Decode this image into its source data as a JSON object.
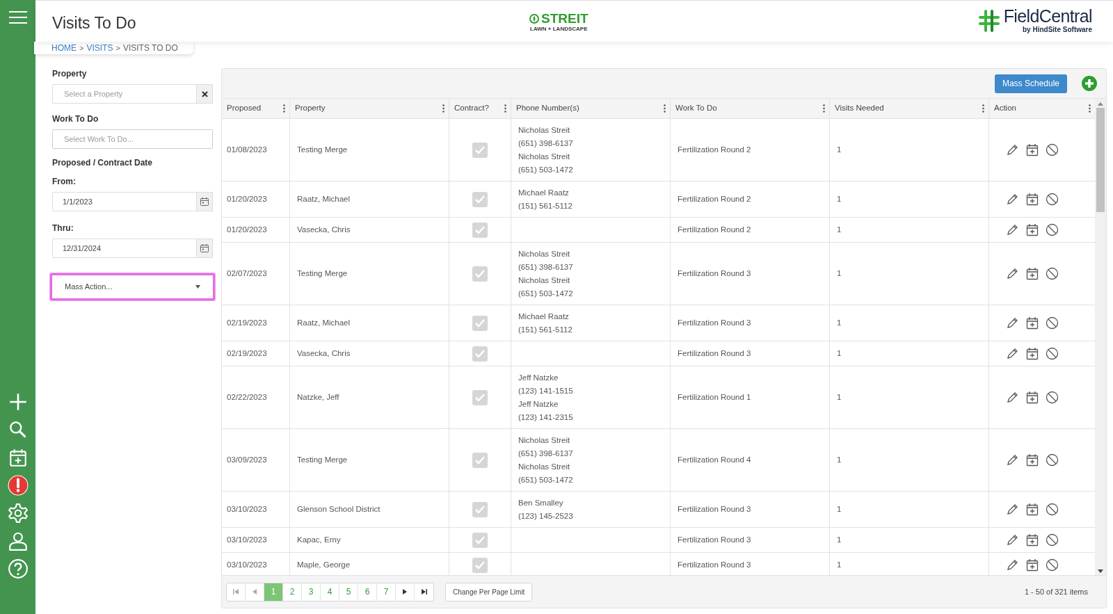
{
  "header": {
    "title": "Visits To Do",
    "brand_logo": {
      "name": "STREIT",
      "tagline": "LAWN + LANDSCAPE"
    },
    "app_logo": {
      "name": "FieldCentral",
      "tagline": "by HindSite Software"
    }
  },
  "breadcrumb": {
    "separator": ">",
    "items": [
      {
        "label": "HOME",
        "link": true
      },
      {
        "label": "VISITS",
        "link": true
      },
      {
        "label": "VISITS TO DO",
        "link": false
      }
    ]
  },
  "sidebar": {
    "items": [
      {
        "kind": "add"
      },
      {
        "kind": "search"
      },
      {
        "kind": "calendar"
      },
      {
        "kind": "alert"
      },
      {
        "kind": "settings"
      },
      {
        "kind": "user"
      },
      {
        "kind": "help"
      }
    ]
  },
  "filters": {
    "property": {
      "label": "Property",
      "placeholder": "Select a Property"
    },
    "work_to_do": {
      "label": "Work To Do",
      "placeholder": "Select Work To Do..."
    },
    "date_label": "Proposed / Contract Date",
    "from": {
      "label": "From:",
      "value": "1/1/2023"
    },
    "thru": {
      "label": "Thru:",
      "value": "12/31/2024"
    },
    "mass_action": {
      "value": "Mass Action...",
      "highlighted": true
    }
  },
  "toolbar": {
    "mass_schedule": "Mass Schedule"
  },
  "table": {
    "columns": [
      "Proposed",
      "Property",
      "Contract?",
      "Phone Number(s)",
      "Work To Do",
      "Visits Needed",
      "Action"
    ],
    "rows": [
      {
        "proposed": "01/08/2023",
        "property": "Testing Merge",
        "contract": true,
        "phones": [
          "Nicholas Streit",
          "(651) 398-6137",
          "Nicholas Streit",
          "(651) 503-1472"
        ],
        "work": "Fertilization Round 2",
        "visits": "1"
      },
      {
        "proposed": "01/20/2023",
        "property": "Raatz, Michael",
        "contract": true,
        "phones": [
          "Michael Raatz",
          "(151) 561-5112"
        ],
        "work": "Fertilization Round 2",
        "visits": "1"
      },
      {
        "proposed": "01/20/2023",
        "property": "Vasecka, Chris",
        "contract": true,
        "phones": [],
        "work": "Fertilization Round 2",
        "visits": "1"
      },
      {
        "proposed": "02/07/2023",
        "property": "Testing Merge",
        "contract": true,
        "phones": [
          "Nicholas Streit",
          "(651) 398-6137",
          "Nicholas Streit",
          "(651) 503-1472"
        ],
        "work": "Fertilization Round 3",
        "visits": "1"
      },
      {
        "proposed": "02/19/2023",
        "property": "Raatz, Michael",
        "contract": true,
        "phones": [
          "Michael Raatz",
          "(151) 561-5112"
        ],
        "work": "Fertilization Round 3",
        "visits": "1"
      },
      {
        "proposed": "02/19/2023",
        "property": "Vasecka, Chris",
        "contract": true,
        "phones": [],
        "work": "Fertilization Round 3",
        "visits": "1"
      },
      {
        "proposed": "02/22/2023",
        "property": "Natzke, Jeff",
        "contract": true,
        "phones": [
          "Jeff Natzke",
          "(123) 141-1515",
          "Jeff Natzke",
          "(123) 141-2315"
        ],
        "work": "Fertilization Round 1",
        "visits": "1"
      },
      {
        "proposed": "03/09/2023",
        "property": "Testing Merge",
        "contract": true,
        "phones": [
          "Nicholas Streit",
          "(651) 398-6137",
          "Nicholas Streit",
          "(651) 503-1472"
        ],
        "work": "Fertilization Round 4",
        "visits": "1"
      },
      {
        "proposed": "03/10/2023",
        "property": "Glenson School District",
        "contract": true,
        "phones": [
          "Ben Smalley",
          "(123) 145-2523"
        ],
        "work": "Fertilization Round 3",
        "visits": "1"
      },
      {
        "proposed": "03/10/2023",
        "property": "Kapac, Erny",
        "contract": true,
        "phones": [],
        "work": "Fertilization Round 3",
        "visits": "1"
      },
      {
        "proposed": "03/10/2023",
        "property": "Maple, George",
        "contract": true,
        "phones": [],
        "work": "Fertilization Round 3",
        "visits": "1"
      }
    ]
  },
  "pagination": {
    "pages": [
      {
        "label": "1",
        "selected": true
      },
      {
        "label": "2",
        "selected": false
      },
      {
        "label": "3",
        "selected": false
      },
      {
        "label": "4",
        "selected": false
      },
      {
        "label": "5",
        "selected": false
      },
      {
        "label": "6",
        "selected": false
      },
      {
        "label": "7",
        "selected": false
      }
    ],
    "per_page_button": "Change Per Page Limit",
    "summary": "1 - 50 of 321 items"
  }
}
